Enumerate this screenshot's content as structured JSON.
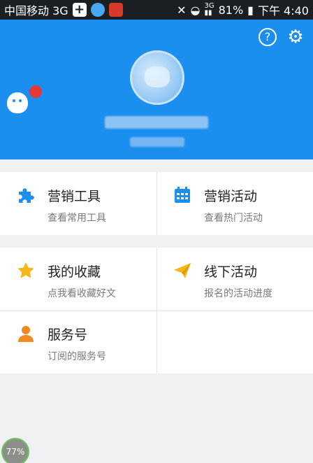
{
  "status_bar": {
    "carrier": "中国移动 3G",
    "net_type": "3G",
    "battery": "81%",
    "time": "下午 4:40"
  },
  "header": {
    "help_icon": "?",
    "settings_icon": "gear-icon"
  },
  "menu": {
    "marketing_tools": {
      "title": "营销工具",
      "desc": "查看常用工具",
      "icon": "puzzle-icon",
      "color": "#1b8ff0"
    },
    "marketing_events": {
      "title": "营销活动",
      "desc": "查看热门活动",
      "icon": "calendar-icon",
      "color": "#1b8ff0"
    },
    "favorites": {
      "title": "我的收藏",
      "desc": "点我看收藏好文",
      "icon": "star-icon",
      "color": "#f6b619"
    },
    "offline_events": {
      "title": "线下活动",
      "desc": "报名的活动进度",
      "icon": "paper-plane-icon",
      "color": "#f6b619"
    },
    "service_account": {
      "title": "服务号",
      "desc": "订阅的服务号",
      "icon": "person-icon",
      "color": "#f08a24"
    }
  },
  "floating_button": {
    "label": "77%"
  },
  "colors": {
    "brand": "#1b8ff0",
    "background": "#eef0f3"
  }
}
